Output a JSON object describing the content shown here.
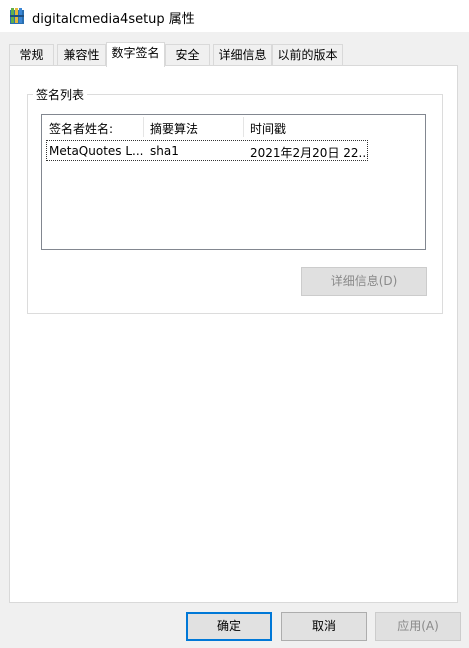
{
  "window": {
    "title": "digitalcmedia4setup 属性"
  },
  "tabs": [
    {
      "label": "常规",
      "active": false
    },
    {
      "label": "兼容性",
      "active": false
    },
    {
      "label": "数字签名",
      "active": true
    },
    {
      "label": "安全",
      "active": false
    },
    {
      "label": "详细信息",
      "active": false
    },
    {
      "label": "以前的版本",
      "active": false
    }
  ],
  "signature_list": {
    "group_label": "签名列表",
    "columns": [
      "签名者姓名:",
      "摘要算法",
      "时间戳"
    ],
    "rows": [
      {
        "signer": "MetaQuotes L...",
        "digest": "sha1",
        "timestamp": "2021年2月20日 22..."
      }
    ],
    "details_button": "详细信息(D)"
  },
  "footer": {
    "ok": "确定",
    "cancel": "取消",
    "apply": "应用(A)"
  },
  "icons": {
    "app": "setup-package-icon"
  },
  "colors": {
    "focus_border": "#0078d7",
    "panel_bg": "#ffffff",
    "dialog_bg": "#f0f0f0"
  }
}
